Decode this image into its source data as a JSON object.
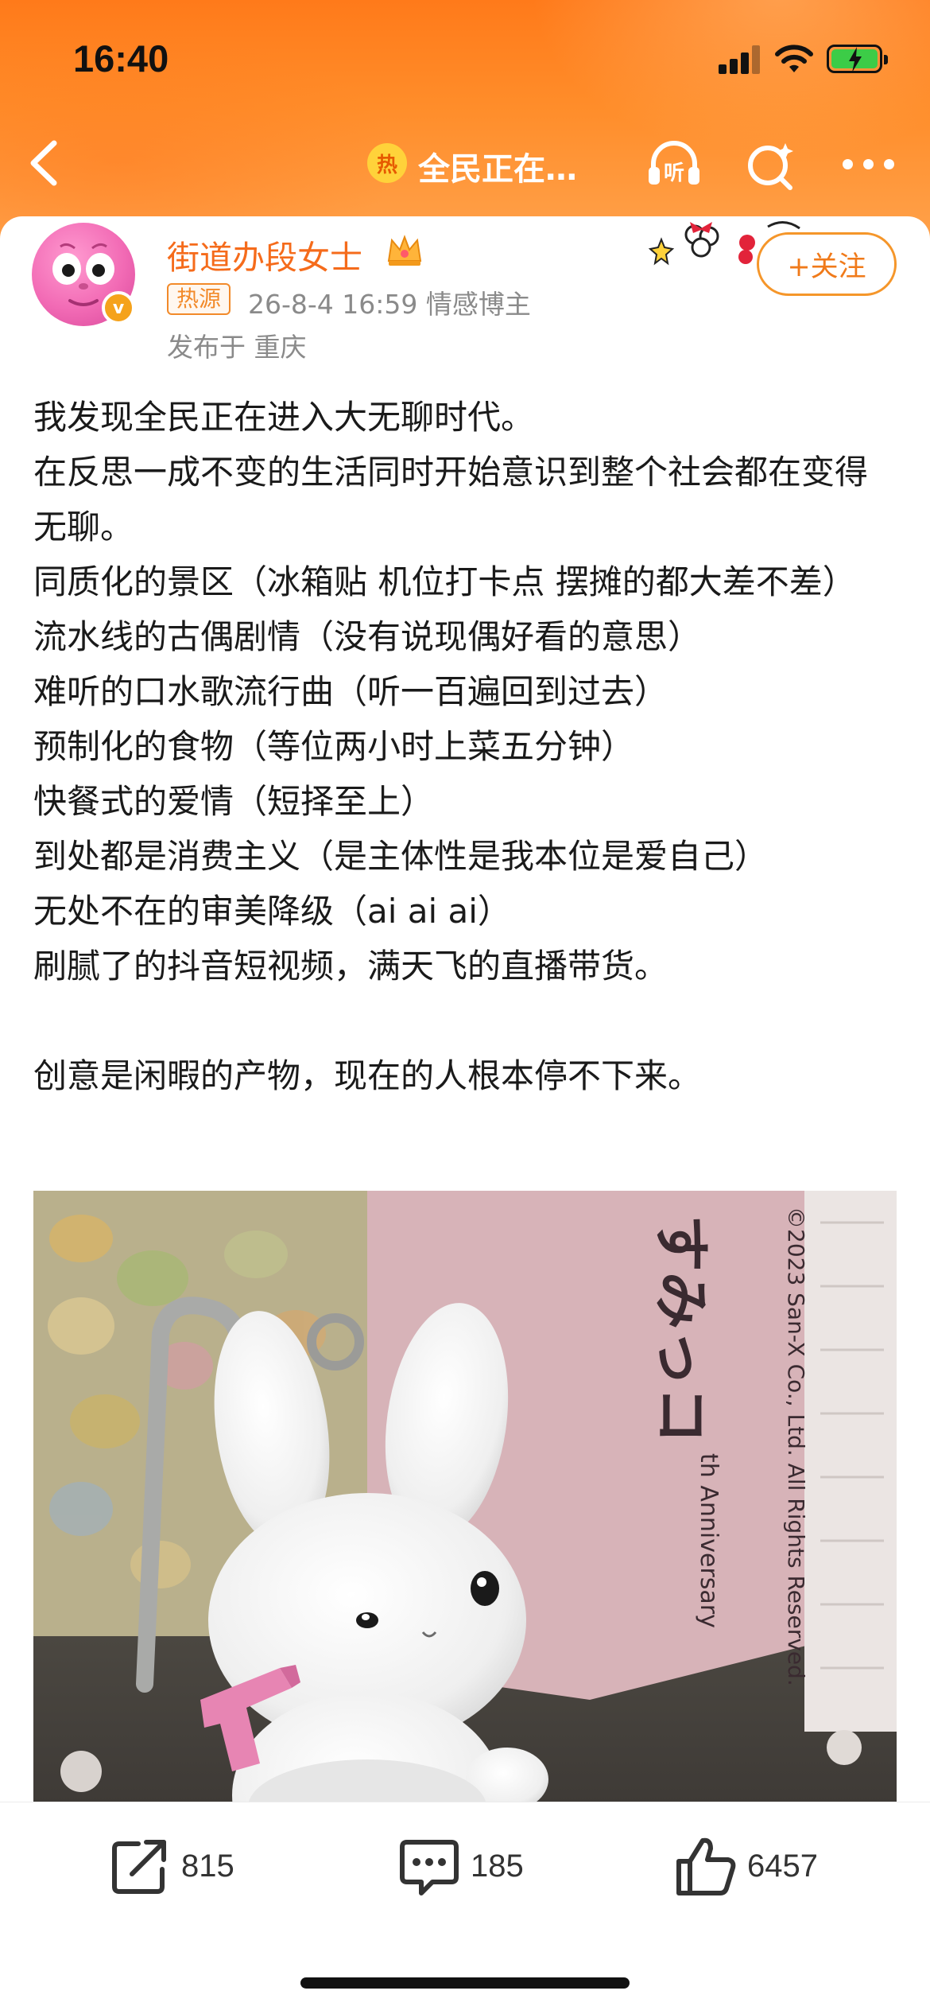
{
  "status_bar": {
    "time": "16:40"
  },
  "nav": {
    "topic_icon_text": "热",
    "title": "全民正在…"
  },
  "author": {
    "name": "街道办段女士",
    "tag": "热源",
    "meta": "26-8-4 16:59  情感博主",
    "location": "发布于 重庆",
    "verified_mark": "v"
  },
  "follow": {
    "label": "+关注"
  },
  "post": {
    "text": "我发现全民正在进入大无聊时代。\n在反思一成不变的生活同时开始意识到整个社会都在变得无聊。\n同质化的景区（冰箱贴 机位打卡点 摆摊的都大差不差）\n流水线的古偶剧情（没有说现偶好看的意思）\n难听的口水歌流行曲（听一百遍回到过去）\n预制化的食物（等位两小时上菜五分钟）\n快餐式的爱情（短择至上）\n到处都是消费主义（是主体性是我本位是爱自己）\n无处不在的审美降级（ai ai ai）\n刷腻了的抖音短视频，满天飞的直播带货。\n\n创意是闲暇的产物，现在的人根本停不下来。",
    "image_text": {
      "vertical_japanese": "すみっコ",
      "copyright": "©2023 San-X Co., Ltd. All Rights Reserved.",
      "anniversary": "th Anniversary"
    }
  },
  "actions": {
    "share_count": "815",
    "comment_count": "185",
    "like_count": "6457"
  },
  "colors": {
    "accent": "#f56b1b",
    "header_gradient_top": "#ff7a1a",
    "header_gradient_bottom": "#ffa14a"
  }
}
